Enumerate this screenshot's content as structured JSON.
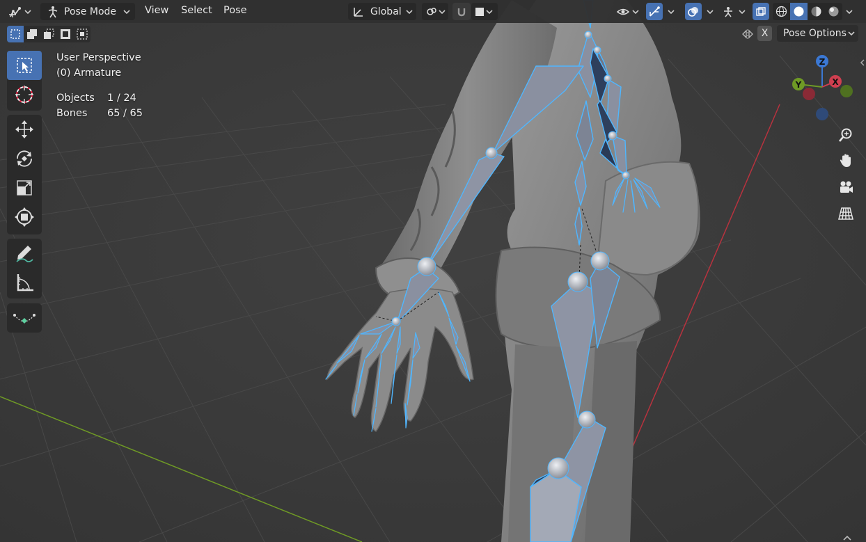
{
  "header": {
    "mode_label": "Pose Mode",
    "menus": [
      "View",
      "Select",
      "Pose"
    ],
    "orientation_label": "Global"
  },
  "overlay": {
    "view_name": "User Perspective",
    "object_name": "(0) Armature",
    "objects_label": "Objects",
    "objects_value": "1 / 24",
    "bones_label": "Bones",
    "bones_value": "65 / 65"
  },
  "right_header": {
    "x_label": "X",
    "pose_options_label": "Pose Options"
  },
  "gizmo": {
    "z_label": "Z",
    "y_label": "Y",
    "x_label": "X"
  },
  "colors": {
    "accent": "#4772b3",
    "bone_outline": "#4fb6ff",
    "bone_fill": "#7d8494",
    "axis_x": "#cf3f50",
    "axis_y": "#6f9a25",
    "axis_z": "#3b78d4"
  },
  "icons": {
    "editor_type": "armature-pose-icon",
    "tools": [
      "select-box-icon",
      "cursor-icon",
      "move-icon",
      "rotate-icon",
      "scale-icon",
      "transform-icon",
      "annotate-icon",
      "measure-icon",
      "bone-envelope-icon"
    ],
    "nav": [
      "zoom-icon",
      "pan-hand-icon",
      "camera-icon",
      "grid-perspective-icon"
    ]
  }
}
